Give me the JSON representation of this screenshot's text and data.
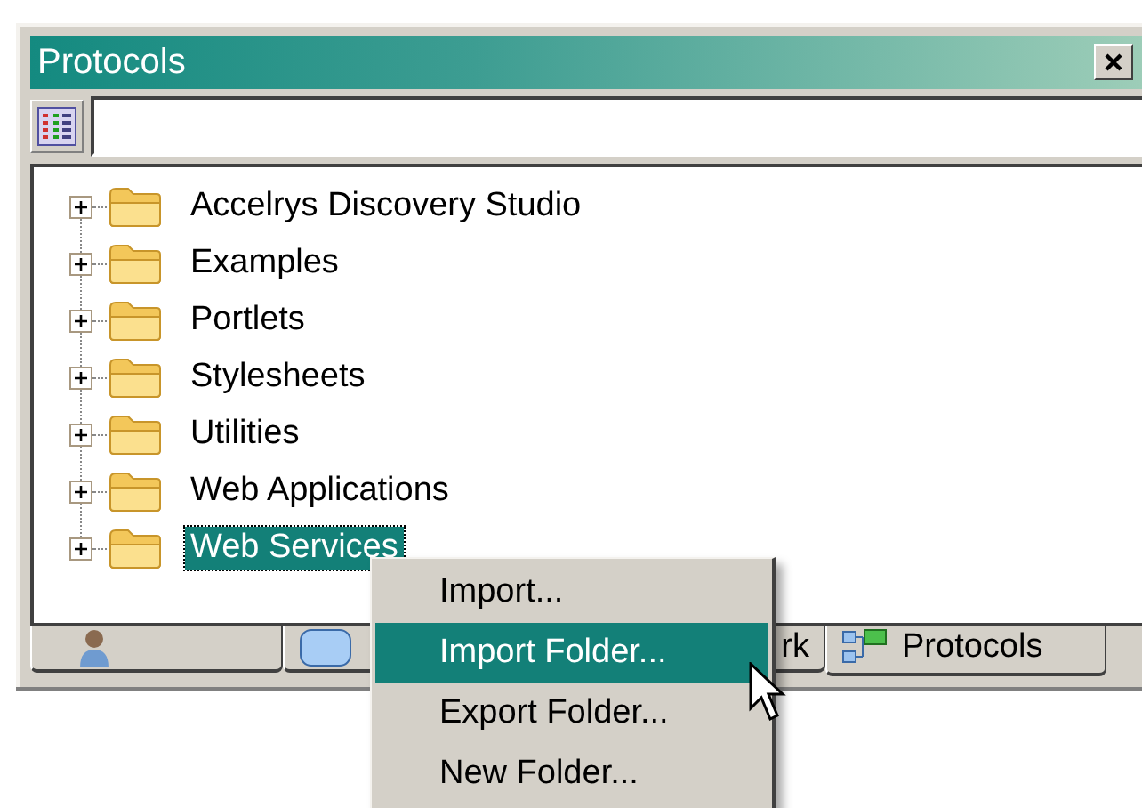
{
  "window": {
    "title": "Protocols"
  },
  "tree": {
    "items": [
      {
        "label": "Accelrys Discovery Studio",
        "expanded": false,
        "selected": false
      },
      {
        "label": "Examples",
        "expanded": false,
        "selected": false
      },
      {
        "label": "Portlets",
        "expanded": false,
        "selected": false
      },
      {
        "label": "Stylesheets",
        "expanded": false,
        "selected": false
      },
      {
        "label": "Utilities",
        "expanded": false,
        "selected": false
      },
      {
        "label": "Web Applications",
        "expanded": false,
        "selected": false
      },
      {
        "label": "Web Services",
        "expanded": false,
        "selected": true
      }
    ]
  },
  "tabs": [
    {
      "selected": false
    },
    {
      "label": "rk",
      "selected": false
    },
    {
      "label": "Protocols",
      "selected": true
    }
  ],
  "context_menu": {
    "items": [
      {
        "label": "Import...",
        "selected": false
      },
      {
        "label": "Import Folder...",
        "selected": true
      },
      {
        "label": "Export Folder...",
        "selected": false
      },
      {
        "label": "New Folder...",
        "selected": false
      }
    ]
  }
}
